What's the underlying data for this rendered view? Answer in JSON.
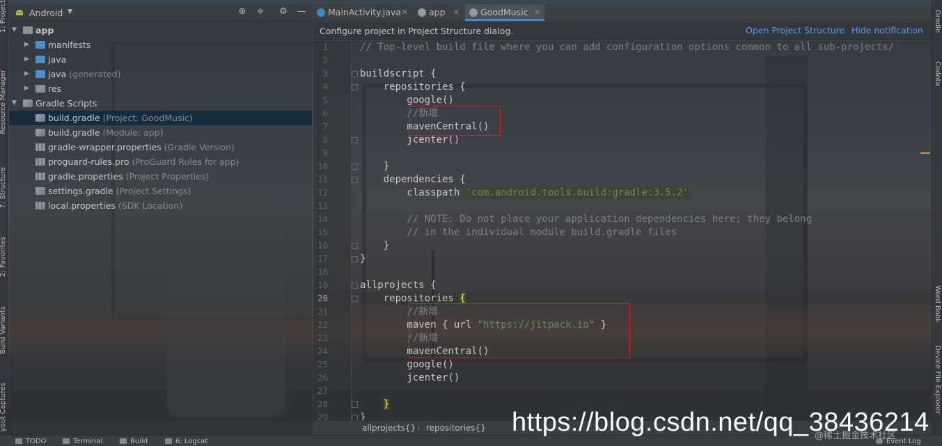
{
  "colors": {
    "accent": "#4a88c7",
    "link": "#589df6",
    "string": "#6a8759",
    "comment": "#808080",
    "highlight_box": "#e02020",
    "bracket": "#ffef28"
  },
  "left_strip": {
    "tabs": [
      "1: Project",
      "Resource Manager",
      "7: Structure",
      "2: Favorites",
      "Build Variants",
      "yout Captures"
    ]
  },
  "right_strip": {
    "tabs": [
      "Gradle",
      "Codota",
      "Word Book",
      "Device File Explorer"
    ]
  },
  "project_panel": {
    "view_title": "Android",
    "tools": [
      "target-icon",
      "collapse-icon",
      "gear-icon",
      "minimize-icon"
    ],
    "tree": [
      {
        "name": "app",
        "hint": "",
        "depth": 0,
        "arrow": "▼",
        "icon": "folder-root",
        "selected": false,
        "bold": true
      },
      {
        "name": "manifests",
        "hint": "",
        "depth": 1,
        "arrow": "▶",
        "icon": "folder-blue",
        "selected": false
      },
      {
        "name": "java",
        "hint": "",
        "depth": 1,
        "arrow": "▶",
        "icon": "folder-blue",
        "selected": false
      },
      {
        "name": "java",
        "hint": "(generated)",
        "depth": 1,
        "arrow": "▶",
        "icon": "folder-gen",
        "selected": false
      },
      {
        "name": "res",
        "hint": "",
        "depth": 1,
        "arrow": "▶",
        "icon": "folder-res",
        "selected": false
      },
      {
        "name": "Gradle Scripts",
        "hint": "",
        "depth": 0,
        "arrow": "▼",
        "icon": "gradle",
        "selected": false
      },
      {
        "name": "build.gradle",
        "hint": "(Project: GoodMusic)",
        "depth": 1,
        "arrow": "",
        "icon": "gradle",
        "selected": true
      },
      {
        "name": "build.gradle",
        "hint": "(Module: app)",
        "depth": 1,
        "arrow": "",
        "icon": "gradle",
        "selected": false
      },
      {
        "name": "gradle-wrapper.properties",
        "hint": "(Gradle Version)",
        "depth": 1,
        "arrow": "",
        "icon": "props",
        "selected": false
      },
      {
        "name": "proguard-rules.pro",
        "hint": "(ProGuard Rules for app)",
        "depth": 1,
        "arrow": "",
        "icon": "props",
        "selected": false
      },
      {
        "name": "gradle.properties",
        "hint": "(Project Properties)",
        "depth": 1,
        "arrow": "",
        "icon": "props",
        "selected": false
      },
      {
        "name": "settings.gradle",
        "hint": "(Project Settings)",
        "depth": 1,
        "arrow": "",
        "icon": "gradle",
        "selected": false
      },
      {
        "name": "local.properties",
        "hint": "(SDK Location)",
        "depth": 1,
        "arrow": "",
        "icon": "props",
        "selected": false
      }
    ]
  },
  "editor_tabs": [
    {
      "label": "MainActivity.java",
      "icon": "java-class-icon",
      "active": false
    },
    {
      "label": "app",
      "icon": "gradle-icon",
      "active": false
    },
    {
      "label": "GoodMusic",
      "icon": "gradle-icon",
      "active": true
    }
  ],
  "notification": {
    "message": "Configure project in Project Structure dialog.",
    "open_link": "Open Project Structure",
    "hide_link": "Hide notification"
  },
  "code": {
    "current_line": 20,
    "lines": [
      {
        "n": "1",
        "seg": [
          {
            "t": "// Top-level build file where you can add configuration options common to all sub-projects/",
            "c": "cm"
          }
        ]
      },
      {
        "n": "2",
        "seg": []
      },
      {
        "n": "3",
        "seg": [
          {
            "t": "buildscript {"
          }
        ]
      },
      {
        "n": "4",
        "seg": [
          {
            "t": "    repositories {"
          }
        ]
      },
      {
        "n": "5",
        "seg": [
          {
            "t": "        google()"
          }
        ]
      },
      {
        "n": "6",
        "seg": [
          {
            "t": "        //新增",
            "c": "cm"
          }
        ]
      },
      {
        "n": "7",
        "seg": [
          {
            "t": "        mavenCentral()"
          }
        ]
      },
      {
        "n": "8",
        "seg": [
          {
            "t": "        jcenter()"
          }
        ]
      },
      {
        "n": "9",
        "seg": []
      },
      {
        "n": "10",
        "seg": [
          {
            "t": "    }"
          }
        ]
      },
      {
        "n": "11",
        "seg": [
          {
            "t": "    dependencies {"
          }
        ]
      },
      {
        "n": "12",
        "seg": [
          {
            "t": "        classpath "
          },
          {
            "t": "'com.android.tools.build:gradle:3.5.2'",
            "c": "st-hl"
          }
        ]
      },
      {
        "n": "13",
        "seg": []
      },
      {
        "n": "14",
        "seg": [
          {
            "t": "        // NOTE: Do not place your application dependencies here; they belong",
            "c": "cm"
          }
        ]
      },
      {
        "n": "15",
        "seg": [
          {
            "t": "        // in the individual module build.gradle files",
            "c": "cm"
          }
        ]
      },
      {
        "n": "16",
        "seg": [
          {
            "t": "    }"
          }
        ]
      },
      {
        "n": "17",
        "seg": [
          {
            "t": "}"
          }
        ]
      },
      {
        "n": "18",
        "seg": []
      },
      {
        "n": "19",
        "seg": [
          {
            "t": "allprojects {"
          }
        ]
      },
      {
        "n": "20",
        "seg": [
          {
            "t": "    repositories "
          },
          {
            "t": "{",
            "c": "brk"
          }
        ]
      },
      {
        "n": "21",
        "seg": [
          {
            "t": "        //新增",
            "c": "cm"
          }
        ]
      },
      {
        "n": "22",
        "seg": [
          {
            "t": "        maven { url "
          },
          {
            "t": "\"https://jitpack.io\"",
            "c": "st"
          },
          {
            "t": " }"
          }
        ]
      },
      {
        "n": "23",
        "seg": [
          {
            "t": "        //新增",
            "c": "cm"
          }
        ]
      },
      {
        "n": "24",
        "seg": [
          {
            "t": "        mavenCentral()"
          }
        ]
      },
      {
        "n": "25",
        "seg": [
          {
            "t": "        google()"
          }
        ]
      },
      {
        "n": "26",
        "seg": [
          {
            "t": "        jcenter()"
          }
        ]
      },
      {
        "n": "27",
        "seg": []
      },
      {
        "n": "28",
        "seg": [
          {
            "t": "    "
          },
          {
            "t": "}",
            "c": "brk"
          }
        ]
      },
      {
        "n": "29",
        "seg": [
          {
            "t": "}"
          }
        ]
      }
    ]
  },
  "breadcrumbs": [
    "allprojects{}",
    "repositories{}"
  ],
  "bottom_bar": {
    "tabs": [
      "TODO",
      "Terminal",
      "Build",
      "6: Logcat"
    ],
    "event_log": "Event Log"
  },
  "watermark": {
    "url": "https://blog.csdn.net/qq_38436214",
    "sub": "@稀土掘金技术社区"
  }
}
